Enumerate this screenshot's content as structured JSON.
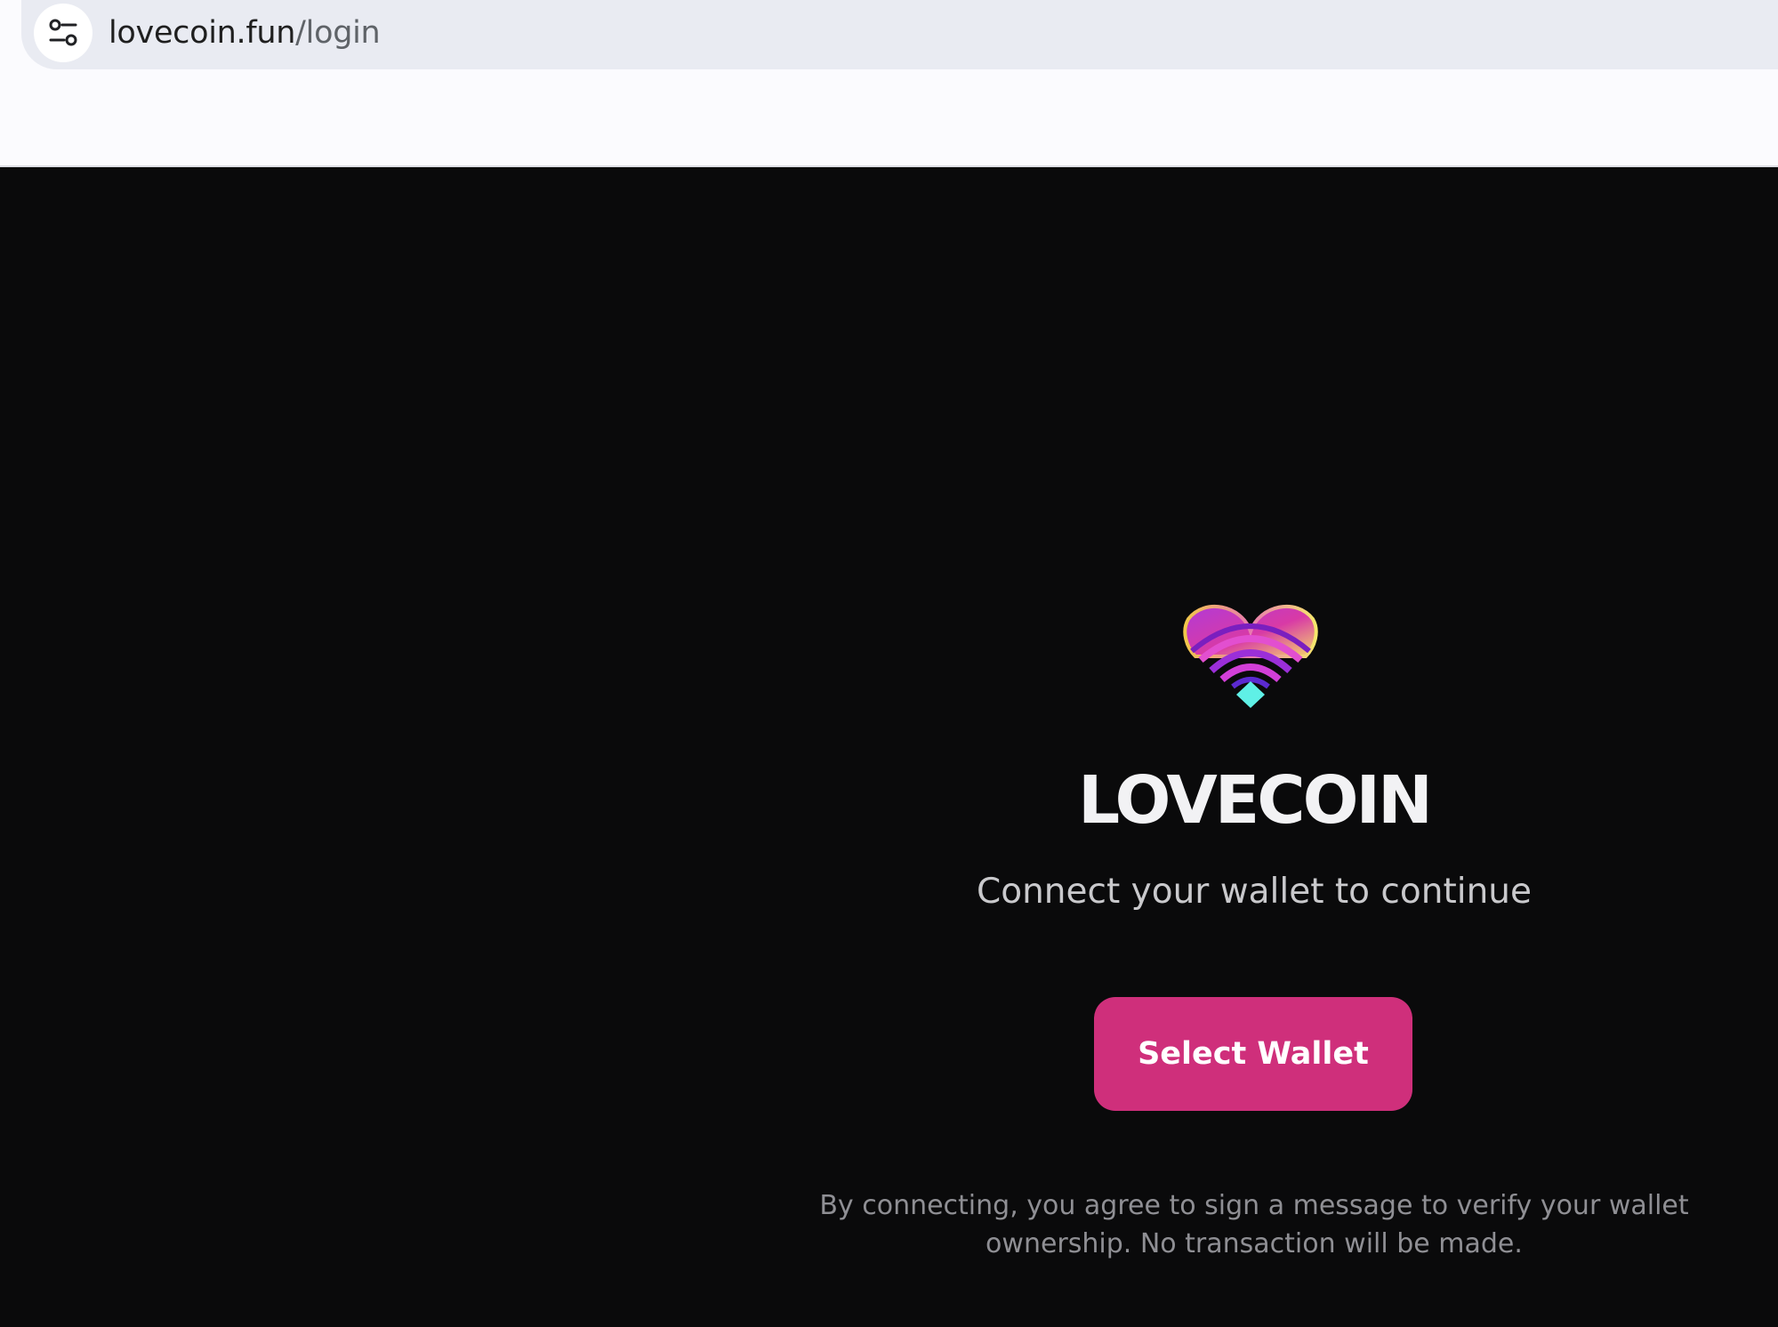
{
  "browser": {
    "url_host": "lovecoin.fun",
    "url_path": "/login",
    "site_info_icon": "tune-icon"
  },
  "page": {
    "logo_icon": "heart-wifi-logo-icon",
    "title": "LOVECOIN",
    "subtitle": "Connect your wallet to continue",
    "select_wallet_label": "Select Wallet",
    "disclaimer": "By connecting, you agree to sign a message to verify your wallet ownership. No transaction will be made."
  },
  "colors": {
    "background": "#0a0a0b",
    "button": "#cf2f7b",
    "title": "#f2f2f4",
    "subtitle": "#c9c9cc",
    "disclaimer": "#8f8f94",
    "logo_diamond": "#5ff0e6"
  }
}
